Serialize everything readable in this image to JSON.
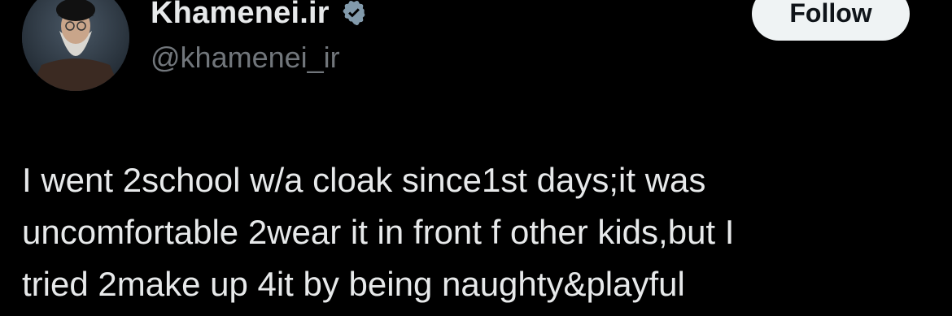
{
  "author": {
    "display_name": "Khamenei.ir",
    "handle": "@khamenei_ir",
    "verified_icon": "verified-badge-icon",
    "avatar_icon": "profile-avatar"
  },
  "follow_button": {
    "label": "Follow"
  },
  "tweet": {
    "lines": [
      "I went 2school w/a cloak since1st days;it was",
      "uncomfortable 2wear it in front f other kids,but I",
      "tried 2make up 4it by being naughty&playful"
    ]
  },
  "colors": {
    "background": "#000000",
    "primary_text": "#e7e9ea",
    "secondary_text": "#71767b",
    "button_bg": "#eff3f4",
    "button_text": "#0f1419",
    "verified_badge": "#829aab"
  }
}
